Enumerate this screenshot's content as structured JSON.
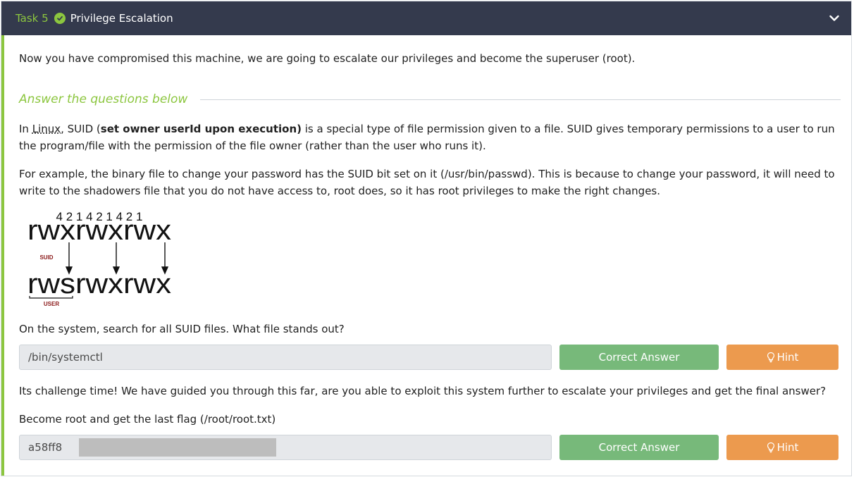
{
  "header": {
    "task_label": "Task 5",
    "title": "Privilege Escalation",
    "status_icon": "check-circle-icon",
    "toggle_icon": "chevron-down-icon"
  },
  "intro": "Now you have compromised this machine, we are going to escalate our privileges and become the superuser (root).",
  "questions_heading": "Answer the questions below",
  "para1": {
    "pre": "In ",
    "link": "Linux",
    "mid": ", SUID (",
    "bold": "set owner userId upon execution)",
    "post": " is a special type of file permission given to a file. SUID gives temporary permissions to a user to run the program/file with the permission of the file owner (rather than the user who runs it)."
  },
  "para2": "For example, the binary file to change your password has the SUID bit set on it (/usr/bin/passwd). This is because to change your password, it will need to write to the shadowers file that you do not have access to, root does, so it has root privileges to make the right changes.",
  "diagram": {
    "digits": "4 2 1 4 2 1 4 2 1",
    "top_perm": "rwxrwxrwx",
    "bottom_perm": "rwsrwxrwx",
    "suid_label": "SUID",
    "user_label": "USER"
  },
  "q1": {
    "question": "On the system, search for all SUID files. What file stands out?",
    "answer": "/bin/systemctl",
    "correct_label": "Correct Answer",
    "hint_label": "Hint"
  },
  "challenge_text": "Its challenge time! We have guided you through this far, are you able to exploit this system further to escalate your privileges and get the final answer?",
  "q2": {
    "question": "Become root and get the last flag (/root/root.txt)",
    "answer": "a58ff8",
    "correct_label": "Correct Answer",
    "hint_label": "Hint"
  },
  "colors": {
    "header_bg": "#343a4d",
    "accent_green": "#8cc63f",
    "correct_green": "#77b97a",
    "hint_orange": "#ec9a4e",
    "suid_red": "#8b1a1a"
  }
}
